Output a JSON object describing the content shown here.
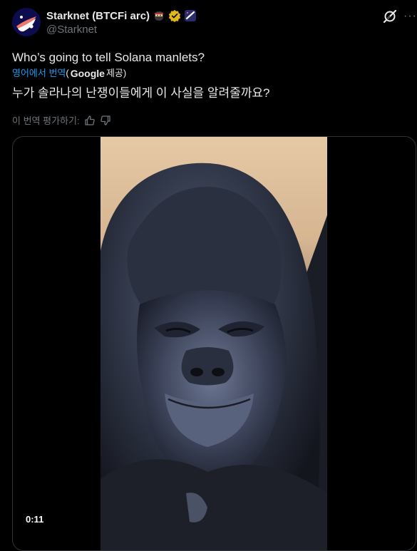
{
  "post": {
    "author": {
      "display_name": "Starknet (BTCFi arc)",
      "handle": "@Starknet",
      "badges": [
        "ninja-emoji",
        "verified-gold-badge",
        "starknet-emoji"
      ]
    },
    "text": "Who’s going to tell Solana manlets?",
    "translation": {
      "translated_from": "영어에서 번역",
      "provider_open": "(",
      "provider": "Google",
      "provider_suffix": "제공)",
      "text": "누가 솔라나의 난쟁이들에게 이 사실을 알려줄까요?",
      "rate_label": "이 번역 평가하기:"
    },
    "media": {
      "type": "video",
      "subject": "gorilla-close-up",
      "duration": "0:11"
    }
  },
  "colors": {
    "background": "#000000",
    "text": "#e7e9ea",
    "muted": "#71767b",
    "link": "#1d9bf0",
    "verified": "#e2b719",
    "border": "#2f3336"
  },
  "icons": [
    "grok-icon",
    "more-icon",
    "thumbs-up-icon",
    "thumbs-down-icon"
  ]
}
